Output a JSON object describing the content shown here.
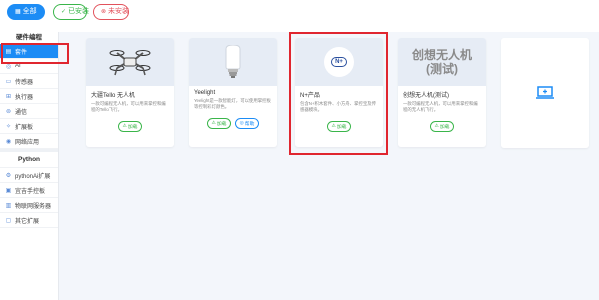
{
  "filters": {
    "all": {
      "label": "全部",
      "icon": "grid-icon"
    },
    "installed": {
      "label": "已安装",
      "icon": "check-circle-icon"
    },
    "uninstalled": {
      "label": "未安装",
      "icon": "x-circle-icon"
    }
  },
  "sidebar": {
    "group1_title": "硬件编程",
    "items": [
      {
        "label": "套件",
        "icon": "kit-icon",
        "active": true
      },
      {
        "label": "AI",
        "icon": "ai-icon"
      },
      {
        "label": "传感器",
        "icon": "sensor-icon"
      },
      {
        "label": "执行器",
        "icon": "actuator-icon"
      },
      {
        "label": "通信",
        "icon": "communication-icon"
      },
      {
        "label": "扩展板",
        "icon": "expansion-board-icon"
      },
      {
        "label": "网络应用",
        "icon": "network-app-icon"
      }
    ],
    "group2_title": "Python",
    "items2": [
      {
        "label": "pythonAi扩展",
        "icon": "python-ai-icon"
      },
      {
        "label": "宜吉手控板",
        "icon": "controller-icon"
      },
      {
        "label": "物联网服务器",
        "icon": "iot-server-icon"
      },
      {
        "label": "其它扩展",
        "icon": "other-ext-icon"
      }
    ]
  },
  "cards": [
    {
      "name": "大疆Tello 无人机",
      "desc": "一款可编程无人机，可以用来掌控和编程的Tello飞行。",
      "load_label": "加载",
      "image": "drone-icon"
    },
    {
      "name": "Yeelight",
      "desc": "Yeelight是一款智能灯，可以使用掌控板等控制彩灯颜色。",
      "load_label": "加载",
      "help_label": "帮助",
      "image": "bulb-icon"
    },
    {
      "name": "N+产品",
      "desc": "包含N+积木套件、小方舟、掌控宝及传感器模块。",
      "load_label": "加载",
      "logo_text": "N+",
      "image": "nplus-logo-icon"
    },
    {
      "name": "创想无人机(测试)",
      "desc": "一款可编程无人机，可以用来掌控和编程的无人机飞行。",
      "load_label": "加载",
      "image_text_line1": "创想无人机",
      "image_text_line2": "(测试)"
    }
  ],
  "add_card": {
    "icon": "laptop-add-icon"
  },
  "colors": {
    "accent": "#1c8cf5",
    "success": "#3ab54a",
    "danger": "#e2525c",
    "highlight": "#e0262f"
  }
}
